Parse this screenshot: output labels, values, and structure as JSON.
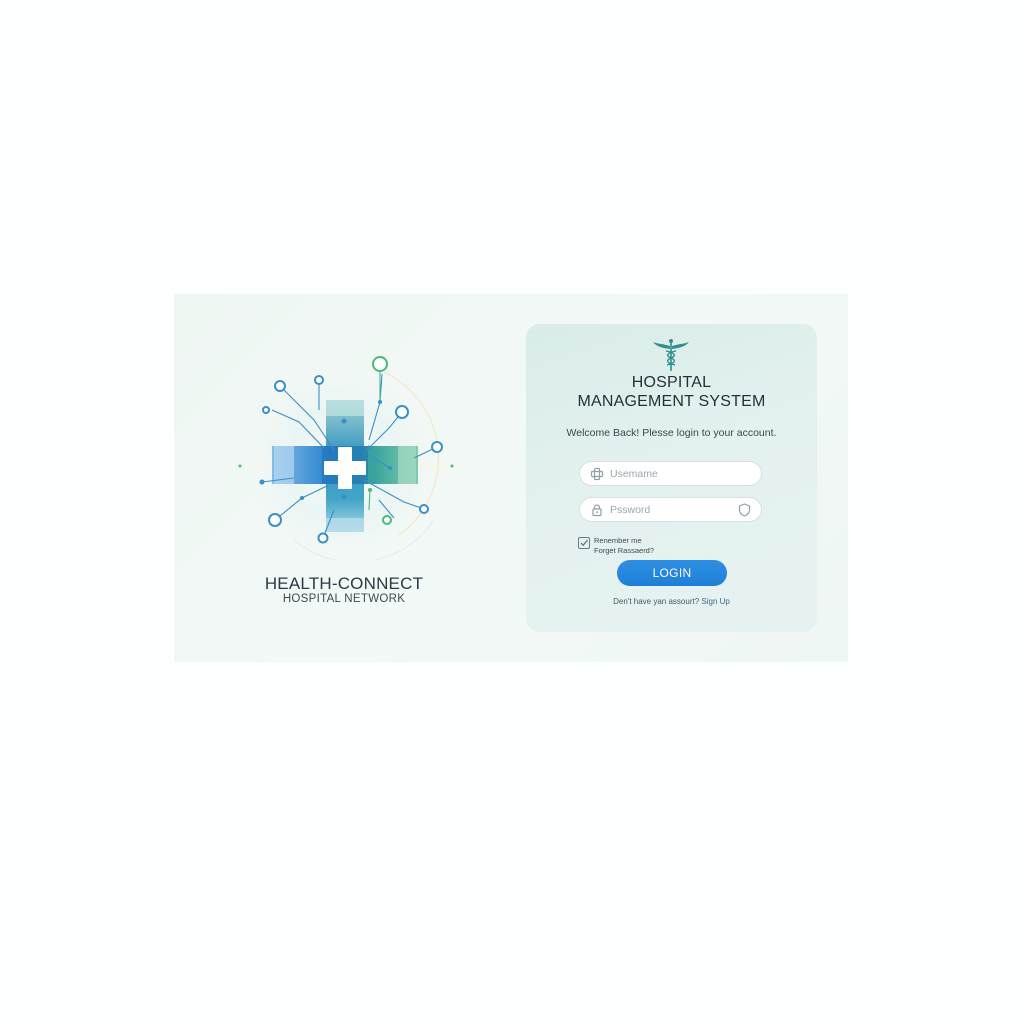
{
  "brand": {
    "name": "HEALTH-CONNECT",
    "tagline": "HOSPITAL NETWORK"
  },
  "login": {
    "title_line1": "HOSPITAL",
    "title_line2": "MANAGEMENT SYSTEM",
    "subtitle": "Welcome Back! Plesse login to your account.",
    "username_placeholder": "Usemame",
    "username_value": "",
    "password_placeholder": "Pssword",
    "password_value": "",
    "remember_label": "Renember me",
    "remember_checked": true,
    "forgot_label": "Forget Rassaerd?",
    "button_label": "LOGIN",
    "signup_prompt": "Den't have yan assourt?",
    "signup_link": "Sign Up"
  },
  "colors": {
    "accent": "#1f7fd8",
    "teal": "#2f8f93",
    "green": "#4cb87c",
    "blue": "#2a84cf"
  },
  "icons": {
    "logo": "medical-cross-network-icon",
    "emblem": "caduceus-icon",
    "username": "user-icon",
    "password": "lock-icon",
    "password_trailing": "shield-icon",
    "remember": "checkbox-checked-icon"
  }
}
